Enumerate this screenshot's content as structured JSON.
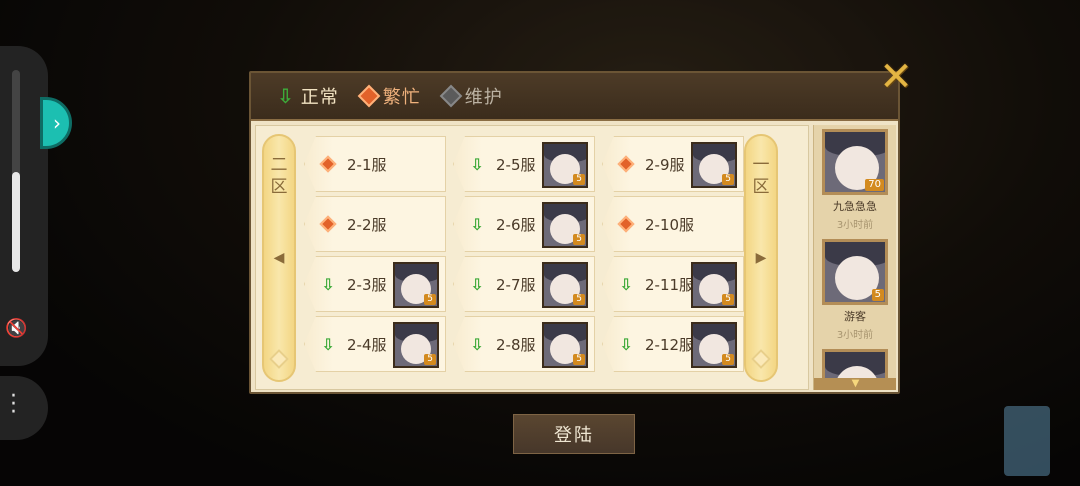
{
  "legend": {
    "normal_label": "正常",
    "busy_label": "繁忙",
    "maintenance_label": "维护"
  },
  "zones": {
    "left_label": "二区",
    "right_label": "一区"
  },
  "servers": [
    {
      "name": "2-1服",
      "status": "busy",
      "avatar_level": ""
    },
    {
      "name": "2-5服",
      "status": "normal",
      "avatar_level": "5"
    },
    {
      "name": "2-9服",
      "status": "busy",
      "avatar_level": "5"
    },
    {
      "name": "2-2服",
      "status": "busy",
      "avatar_level": ""
    },
    {
      "name": "2-6服",
      "status": "normal",
      "avatar_level": "5"
    },
    {
      "name": "2-10服",
      "status": "busy",
      "avatar_level": ""
    },
    {
      "name": "2-3服",
      "status": "normal",
      "avatar_level": "5"
    },
    {
      "name": "2-7服",
      "status": "normal",
      "avatar_level": "5"
    },
    {
      "name": "2-11服",
      "status": "normal",
      "avatar_level": "5"
    },
    {
      "name": "2-4服",
      "status": "normal",
      "avatar_level": "5"
    },
    {
      "name": "2-8服",
      "status": "normal",
      "avatar_level": "5"
    },
    {
      "name": "2-12服",
      "status": "normal",
      "avatar_level": "5"
    }
  ],
  "players": [
    {
      "name": "九急急急",
      "time": "3小时前",
      "level": "70"
    },
    {
      "name": "游客",
      "time": "3小时前",
      "level": "5"
    }
  ],
  "login_label": "登陆",
  "colors": {
    "normal": "#3aa835",
    "busy": "#e2622a",
    "maintenance": "#5b5b5b",
    "accent_teal": "#1cbfb1"
  }
}
